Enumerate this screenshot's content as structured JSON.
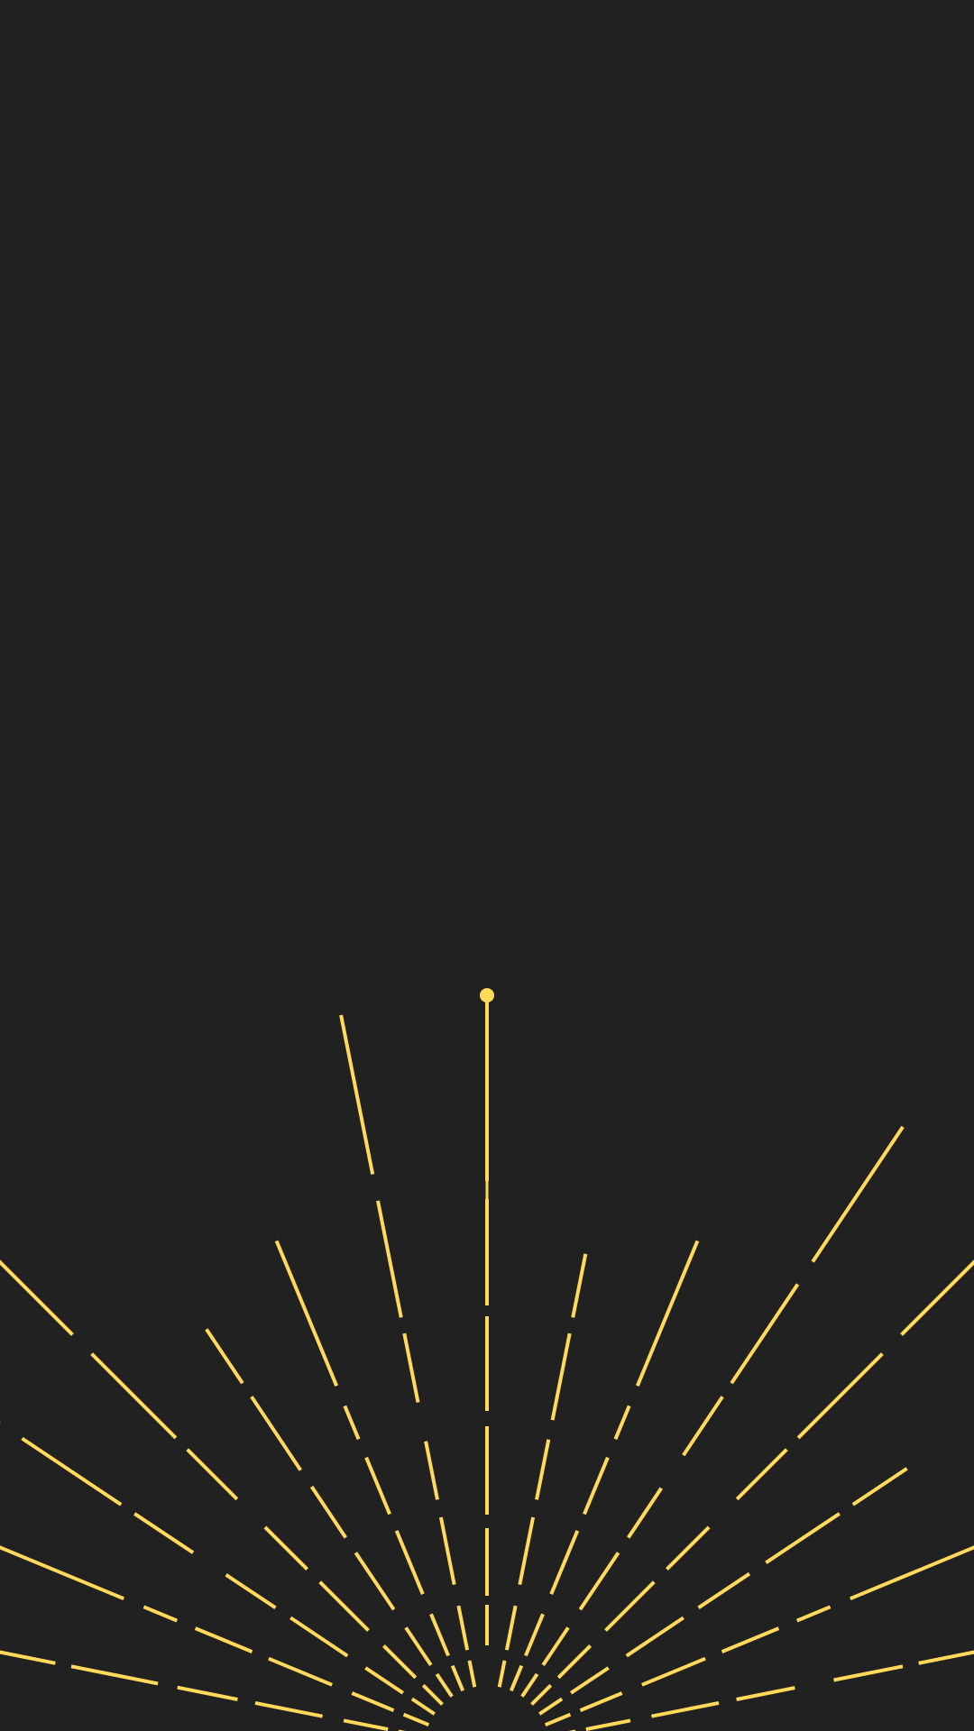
{
  "screen": {
    "background_color": "#212121",
    "accent_color": "#FFD95C"
  },
  "illustration": {
    "name": "sunburst",
    "ray_count": 17,
    "center_ray_has_dot": true
  }
}
